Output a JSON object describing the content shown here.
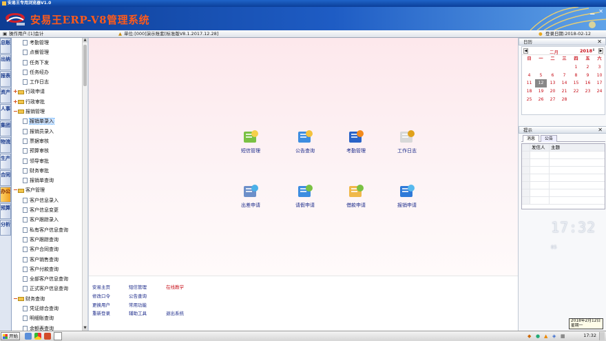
{
  "window": {
    "title": "安易王专用浏览器V1.0",
    "app_title": "安易王ERP-V8管理系统"
  },
  "infobar": {
    "operator": "操作用户:[1]会计",
    "unit": "单位:[000]演示账套[标准版V8.1.2017.12.28]",
    "login_date": "登录日期:2018-02-12"
  },
  "left_tabs": [
    "总账",
    "出纳",
    "报表",
    "资产",
    "人事",
    "集团",
    "物流",
    "生产",
    "合同",
    "办公",
    "预算",
    "分析"
  ],
  "active_tab": "办公",
  "tree": [
    {
      "label": "考勤管理",
      "type": "child"
    },
    {
      "label": "点餐管理",
      "type": "child"
    },
    {
      "label": "任务下发",
      "type": "child"
    },
    {
      "label": "任务经办",
      "type": "child"
    },
    {
      "label": "工作日志",
      "type": "child"
    },
    {
      "label": "行政申请",
      "type": "group",
      "state": "+"
    },
    {
      "label": "行政审批",
      "type": "group",
      "state": "+"
    },
    {
      "label": "报销管理",
      "type": "group",
      "state": "-"
    },
    {
      "label": "报销单录入",
      "type": "child",
      "selected": true
    },
    {
      "label": "报销员录入",
      "type": "child"
    },
    {
      "label": "票据审核",
      "type": "child"
    },
    {
      "label": "预算审核",
      "type": "child"
    },
    {
      "label": "领导审批",
      "type": "child"
    },
    {
      "label": "财务审批",
      "type": "child"
    },
    {
      "label": "报销单查询",
      "type": "child"
    },
    {
      "label": "客户管理",
      "type": "group",
      "state": "-"
    },
    {
      "label": "客户信息录入",
      "type": "child"
    },
    {
      "label": "客户信息变更",
      "type": "child"
    },
    {
      "label": "客户跟踪录入",
      "type": "child"
    },
    {
      "label": "私有客户信息查询",
      "type": "child"
    },
    {
      "label": "客户跟踪查询",
      "type": "child"
    },
    {
      "label": "客户合同查询",
      "type": "child"
    },
    {
      "label": "客户销售查询",
      "type": "child"
    },
    {
      "label": "客户付款查询",
      "type": "child"
    },
    {
      "label": "全部客户信息查询",
      "type": "child"
    },
    {
      "label": "正式客户信息查询",
      "type": "child"
    },
    {
      "label": "财务查询",
      "type": "group",
      "state": "-"
    },
    {
      "label": "凭证综合查询",
      "type": "child"
    },
    {
      "label": "明细账查询",
      "type": "child"
    },
    {
      "label": "余额表查询",
      "type": "child"
    }
  ],
  "main_icons": [
    {
      "label": "短信管理",
      "icon": "sms-table-icon"
    },
    {
      "label": "公告查询",
      "icon": "notice-search-icon"
    },
    {
      "label": "考勤管理",
      "icon": "attendance-icon"
    },
    {
      "label": "工作日志",
      "icon": "worklog-icon"
    },
    {
      "label": "出差申请",
      "icon": "travel-icon"
    },
    {
      "label": "请假申请",
      "icon": "leave-icon"
    },
    {
      "label": "借款申请",
      "icon": "loan-icon"
    },
    {
      "label": "报销申请",
      "icon": "reimburse-icon"
    }
  ],
  "bottom_links": [
    {
      "label": "安易主页"
    },
    {
      "label": "短信管理"
    },
    {
      "label": "在线教学",
      "red": true
    },
    {
      "label": "修改口令"
    },
    {
      "label": "公告查询"
    },
    {
      "label": "更换用户"
    },
    {
      "label": "常用功能"
    },
    {
      "label": "重新登录"
    },
    {
      "label": "辅助工具"
    },
    {
      "label": "退出系统"
    }
  ],
  "calendar": {
    "header": "日历",
    "month": "二月",
    "year": "2018",
    "weekdays": [
      "日",
      "一",
      "二",
      "三",
      "四",
      "五",
      "六"
    ],
    "leading_blanks": 4,
    "days": 28,
    "today": 12
  },
  "notice_panel": {
    "header": "提示",
    "tabs": [
      "消息",
      "公告"
    ],
    "columns": [
      "发信人",
      "主题"
    ]
  },
  "clock": {
    "time": "17:32",
    "seconds": "05"
  },
  "desktop_date": {
    "line1": "2018年2月12日",
    "line2": "星期一"
  },
  "taskbar": {
    "start_label": "开始",
    "time": "17:32"
  },
  "colors": {
    "title_accent": "#ff5a1a",
    "banner_blue": "#1e5cc4",
    "link_blue": "#1b2a8a",
    "red": "#c8101a"
  }
}
